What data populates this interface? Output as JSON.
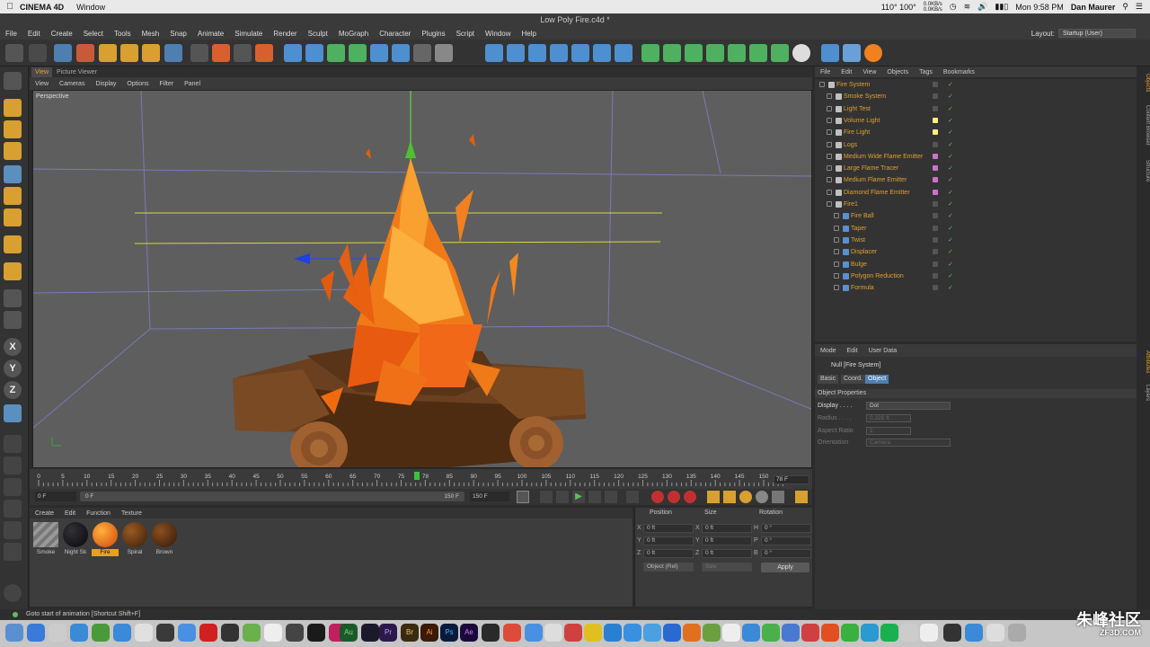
{
  "mac_menubar": {
    "app_name": "CINEMA 4D",
    "menu_window": "Window",
    "document_title": "Low Poly Fire.c4d *",
    "net_up": "0.0KB/s",
    "net_down": "0.0KB/s",
    "temperature": "110° 100°",
    "datetime": "Mon 9:58 PM",
    "user": "Dan Maurer"
  },
  "app_menu": {
    "items": [
      "File",
      "Edit",
      "Create",
      "Select",
      "Tools",
      "Mesh",
      "Snap",
      "Animate",
      "Simulate",
      "Render",
      "Sculpt",
      "MoGraph",
      "Character",
      "Plugins",
      "Script",
      "Window",
      "Help"
    ],
    "layout_label": "Layout:",
    "layout_value": "Startup (User)"
  },
  "viewport": {
    "tabs": [
      "View",
      "Picture Viewer"
    ],
    "menu": [
      "View",
      "Cameras",
      "Display",
      "Options",
      "Filter",
      "Panel"
    ],
    "label": "Perspective"
  },
  "timeline": {
    "ticks": [
      "0",
      "5",
      "10",
      "15",
      "20",
      "25",
      "30",
      "35",
      "40",
      "45",
      "50",
      "55",
      "60",
      "65",
      "70",
      "75",
      "78",
      "85",
      "90",
      "95",
      "100",
      "105",
      "110",
      "115",
      "120",
      "125",
      "130",
      "135",
      "140",
      "145",
      "150"
    ],
    "current_frame": "78 F",
    "start": "0 F",
    "min": "0 F",
    "max": "150 F",
    "end": "150 F"
  },
  "materials": {
    "menu": [
      "Create",
      "Edit",
      "Function",
      "Texture"
    ],
    "items": [
      {
        "name": "Smoke",
        "color": "#8a8a8a"
      },
      {
        "name": "Night Sk",
        "color": "#151520"
      },
      {
        "name": "Fire",
        "color": "#f07010"
      },
      {
        "name": "Spiral",
        "color": "#6a3a12"
      },
      {
        "name": "Brown",
        "color": "#5a3210"
      }
    ]
  },
  "coords": {
    "headers": [
      "Position",
      "Size",
      "Rotation"
    ],
    "rows": [
      {
        "axis": "X",
        "pos": "0 ft",
        "size_axis": "X",
        "size": "0 ft",
        "rot_axis": "H",
        "rot": "0 °"
      },
      {
        "axis": "Y",
        "pos": "0 ft",
        "size_axis": "Y",
        "size": "0 ft",
        "rot_axis": "P",
        "rot": "0 °"
      },
      {
        "axis": "Z",
        "pos": "0 ft",
        "size_axis": "Z",
        "size": "0 ft",
        "rot_axis": "B",
        "rot": "0 °"
      }
    ],
    "mode": "Object (Rel)",
    "size_mode": "Size",
    "apply": "Apply"
  },
  "objects": {
    "menu": [
      "File",
      "Edit",
      "View",
      "Objects",
      "Tags",
      "Bookmarks"
    ],
    "items": [
      {
        "name": "Fire System",
        "indent": 0
      },
      {
        "name": "Smoke System",
        "indent": 1
      },
      {
        "name": "Light Test",
        "indent": 1
      },
      {
        "name": "Volume Light",
        "indent": 1
      },
      {
        "name": "Fire Light",
        "indent": 1
      },
      {
        "name": "Logs",
        "indent": 1
      },
      {
        "name": "Medium Wide Flame Emitter",
        "indent": 1
      },
      {
        "name": "Large Flame Tracer",
        "indent": 1
      },
      {
        "name": "Medium Flame Emitter",
        "indent": 1
      },
      {
        "name": "Diamond Flame Emitter",
        "indent": 1
      },
      {
        "name": "Fire1",
        "indent": 1
      },
      {
        "name": "Fire Ball",
        "indent": 2
      },
      {
        "name": "Taper",
        "indent": 2
      },
      {
        "name": "Twist",
        "indent": 2
      },
      {
        "name": "Displacer",
        "indent": 2
      },
      {
        "name": "Bulge",
        "indent": 2
      },
      {
        "name": "Polygon Reduction",
        "indent": 2
      },
      {
        "name": "Formula",
        "indent": 2
      }
    ]
  },
  "attributes": {
    "menu": [
      "Mode",
      "Edit",
      "User Data"
    ],
    "object_title": "Null [Fire System]",
    "tabs": [
      "Basic",
      "Coord.",
      "Object"
    ],
    "section": "Object Properties",
    "display_label": "Display . . . .",
    "display_value": "Dot",
    "radius_label": "Radius . . . .",
    "radius_value": "0.328 ft",
    "aspect_label": "Aspect Ratio",
    "aspect_value": "1",
    "orientation_label": "Orientation",
    "orientation_value": "Camera"
  },
  "side_tabs": {
    "top": [
      "Objects",
      "Content Browser",
      "Structure"
    ],
    "bottom": [
      "Attributes",
      "Layers"
    ]
  },
  "status_text": "Goto start of animation [Shortcut Shift+F]",
  "watermark": {
    "main": "朱峰社区",
    "sub": "ZF3D.COM"
  }
}
